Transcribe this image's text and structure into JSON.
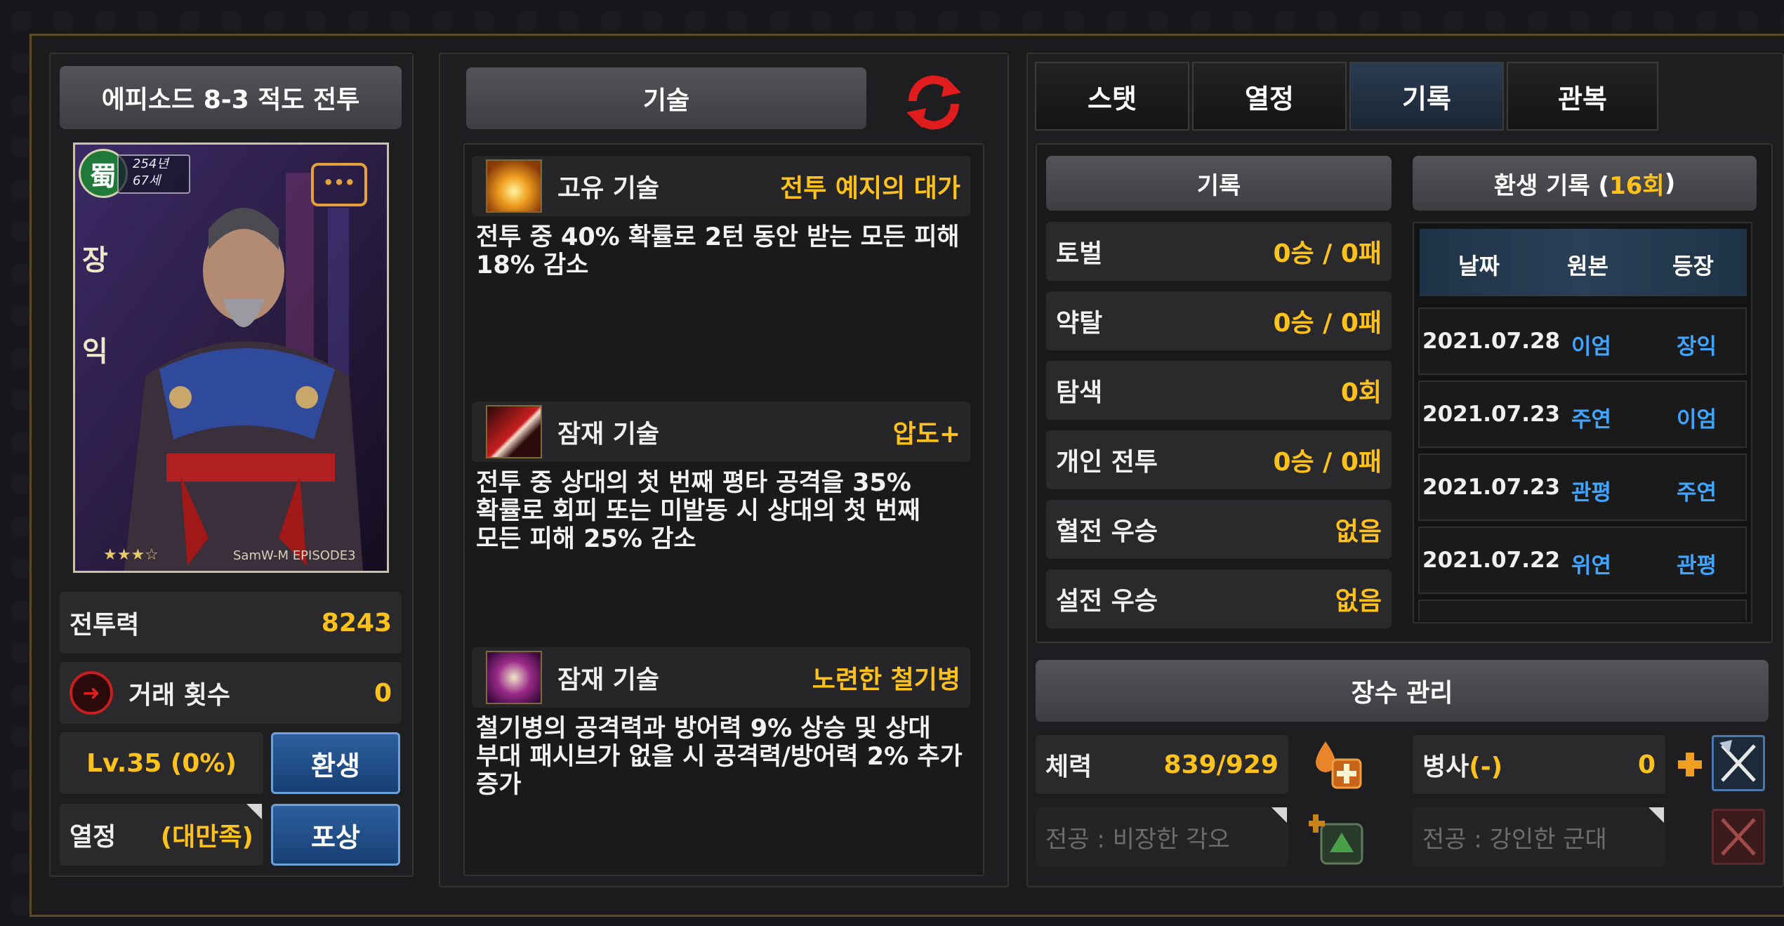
{
  "left": {
    "title": "에피소드 8-3 적도 전투",
    "card": {
      "kingdom_glyph": "蜀",
      "year_line": "254년",
      "age_line": "67세",
      "name_vertical": "장익",
      "watermark": "SamW-M EPISODE3",
      "stars": "★★★☆"
    },
    "power_label": "전투력",
    "power_value": "8243",
    "trade_label": "거래 횟수",
    "trade_value": "0",
    "level_text": "Lv.35 (0%)",
    "rebirth_button": "환생",
    "passion_label": "열정",
    "passion_value": "(대만족)",
    "reward_button": "포상"
  },
  "skills": {
    "title": "기술",
    "items": [
      {
        "type": "고유 기술",
        "name": "전투 예지의 대가",
        "desc1": "전투 중 40% 확률로 2턴 동안 받는 모든 피해",
        "desc2": "18% 감소",
        "desc3": ""
      },
      {
        "type": "잠재 기술",
        "name": "압도+",
        "desc1": "전투 중 상대의 첫 번째 평타 공격을 35%",
        "desc2": "확률로 회피 또는 미발동 시 상대의 첫 번째",
        "desc3": "모든 피해 25% 감소"
      },
      {
        "type": "잠재 기술",
        "name": "노련한 철기병",
        "desc1": "철기병의 공격력과 방어력 9% 상승 및 상대",
        "desc2": "부대 패시브가 없을 시 공격력/방어력 2% 추가",
        "desc3": "증가"
      }
    ]
  },
  "tabs": [
    "스탯",
    "열정",
    "기록",
    "관복"
  ],
  "records": {
    "title": "기록",
    "rows": [
      {
        "label": "토벌",
        "value": "0승 / 0패"
      },
      {
        "label": "약탈",
        "value": "0승 / 0패"
      },
      {
        "label": "탐색",
        "value": "0회"
      },
      {
        "label": "개인 전투",
        "value": "0승 / 0패"
      },
      {
        "label": "혈전 우승",
        "value": "없음"
      },
      {
        "label": "설전 우승",
        "value": "없음"
      }
    ]
  },
  "rebirth": {
    "title_prefix": "환생 기록 (",
    "count": "16회",
    "title_suffix": ")",
    "headers": [
      "날짜",
      "원본",
      "등장"
    ],
    "rows": [
      {
        "date": "2021.07.28",
        "from": "이엄",
        "to": "장익"
      },
      {
        "date": "2021.07.23",
        "from": "주연",
        "to": "이엄"
      },
      {
        "date": "2021.07.23",
        "from": "관평",
        "to": "주연"
      },
      {
        "date": "2021.07.22",
        "from": "위연",
        "to": "관평"
      }
    ]
  },
  "management": {
    "title": "장수 관리",
    "hp_label": "체력",
    "hp_value": "839/929",
    "troop_label": "병사",
    "troop_suffix": "(-)",
    "troop_value": "0",
    "merit1": "전공 : 비장한 각오",
    "merit2": "전공 : 강인한 군대"
  },
  "colors": {
    "accent": "#ffc21a",
    "link": "#3fa5ff",
    "refresh": "#e01c1c",
    "button": "#1f4d86"
  }
}
